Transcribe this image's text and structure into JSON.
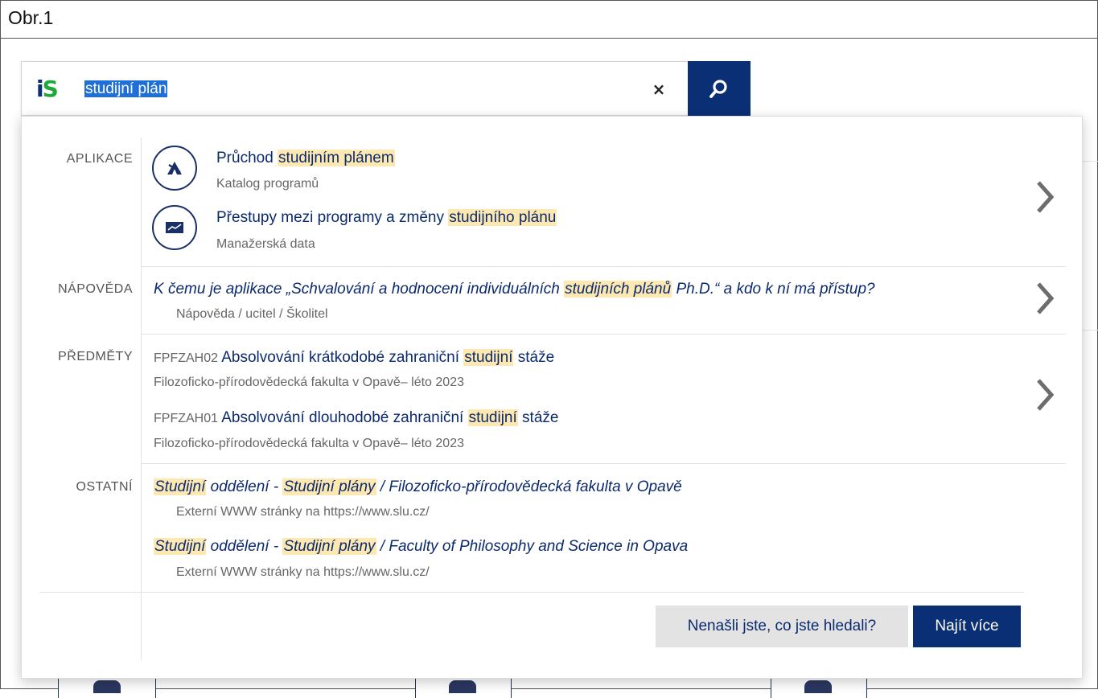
{
  "caption": "Obr.1",
  "search": {
    "logo_i": "i",
    "logo_s": "S",
    "query": "studijní plán",
    "clear_icon": "×",
    "search_icon": "magnifier-icon"
  },
  "sections": {
    "aplikace": {
      "label": "APLIKACE",
      "items": [
        {
          "icon": "compass-icon",
          "title_pre": "Průchod ",
          "title_hl": "studijním plánem",
          "title_post": "",
          "subtitle": "Katalog programů"
        },
        {
          "icon": "chart-icon",
          "title_pre": "Přestupy mezi programy a změny ",
          "title_hl": "studijního plánu",
          "title_post": "",
          "subtitle": "Manažerská data"
        }
      ]
    },
    "napoveda": {
      "label": "NÁPOVĚDA",
      "items": [
        {
          "title_pre": "K čemu je aplikace „Schvalování a hodnocení individuálních ",
          "title_hl": "studijních plánů",
          "title_post": " Ph.D.“ a kdo k ní má přístup?",
          "subtitle": "Nápověda / ucitel / Školitel"
        }
      ]
    },
    "predmety": {
      "label": "PŘEDMĚTY",
      "items": [
        {
          "code": "FPFZAH02",
          "title_pre": " Absolvování krátkodobé zahraniční ",
          "title_hl": "studijní",
          "title_post": " stáže",
          "subtitle": "Filozoficko-přírodovědecká fakulta v Opavě– léto 2023"
        },
        {
          "code": "FPFZAH01",
          "title_pre": " Absolvování dlouhodobé zahraniční ",
          "title_hl": "studijní",
          "title_post": " stáže",
          "subtitle": "Filozoficko-přírodovědecká fakulta v Opavě– léto 2023"
        }
      ]
    },
    "ostatni": {
      "label": "OSTATNÍ",
      "items": [
        {
          "hl1": "Studijní",
          "mid": " oddělení - ",
          "hl2": "Studijní plány",
          "post": " / Filozoficko-přírodovědecká fakulta v Opavě",
          "subtitle": "Externí WWW stránky na https://www.slu.cz/"
        },
        {
          "hl1": "Studijní",
          "mid": " oddělení - ",
          "hl2": "Studijní plány",
          "post": " / Faculty of Philosophy and Science in Opava",
          "subtitle": "Externí WWW stránky na https://www.slu.cz/"
        }
      ]
    }
  },
  "buttons": {
    "not_found": "Nenašli jste, co jste hledali?",
    "find_more": "Najít více"
  },
  "colors": {
    "primary": "#0b2f75",
    "highlight": "#fde8b2",
    "logo_green": "#1eaa38"
  }
}
